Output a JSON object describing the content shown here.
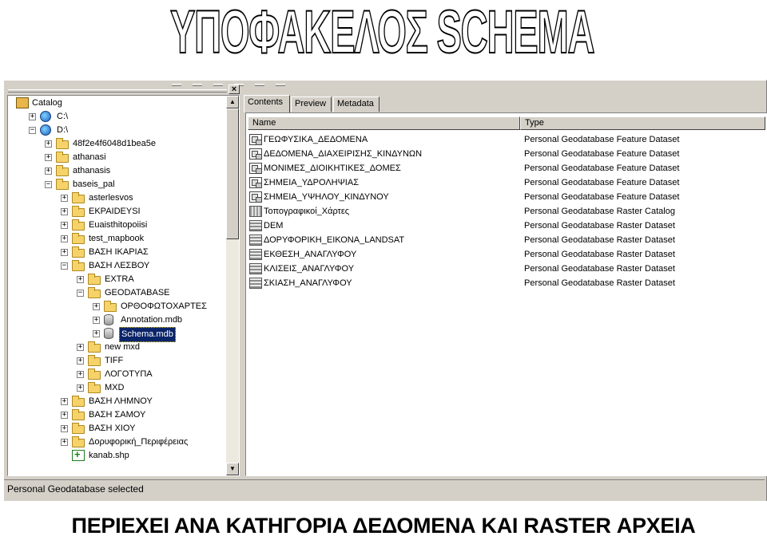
{
  "heading": "ΥΠΟΦΑΚΕΛΟΣ SCHEMA",
  "caption": "ΠΕΡΙΕΧΕΙ ΑΝΑ ΚΑΤΗΓΟΡΙΑ ΔΕΔΟΜΕΝΑ ΚΑΙ RASTER ΑΡΧΕΙΑ",
  "tree": {
    "close_label": "×",
    "items": [
      {
        "label": "Catalog",
        "icon": "catalog-icon",
        "expander": ""
      },
      {
        "label": "C:\\",
        "icon": "drive-icon",
        "expander": "+"
      },
      {
        "label": "D:\\",
        "icon": "drive-icon",
        "expander": "−"
      },
      {
        "label": "48f2e4f6048d1bea5e",
        "icon": "folder-icon",
        "expander": "+"
      },
      {
        "label": "athanasi",
        "icon": "folder-icon",
        "expander": "+"
      },
      {
        "label": "athanasis",
        "icon": "folder-icon",
        "expander": "+"
      },
      {
        "label": "baseis_pal",
        "icon": "folder-icon",
        "expander": "−"
      },
      {
        "label": "asterlesvos",
        "icon": "folder-icon",
        "expander": "+"
      },
      {
        "label": "EKPAIDEYSI",
        "icon": "folder-icon",
        "expander": "+"
      },
      {
        "label": "Euaisthitopoiisi",
        "icon": "folder-icon",
        "expander": "+"
      },
      {
        "label": "test_mapbook",
        "icon": "folder-icon",
        "expander": "+"
      },
      {
        "label": "ΒΑΣΗ ΙΚΑΡΙΑΣ",
        "icon": "folder-icon",
        "expander": "+"
      },
      {
        "label": "ΒΑΣΗ ΛΕΣΒΟΥ",
        "icon": "folder-icon",
        "expander": "−"
      },
      {
        "label": "EXTRA",
        "icon": "folder-icon",
        "expander": "+"
      },
      {
        "label": "GEODATABASE",
        "icon": "folder-icon",
        "expander": "−"
      },
      {
        "label": "ΟΡΘΟΦΩΤΟΧΑΡΤΕΣ",
        "icon": "folder-icon",
        "expander": "+"
      },
      {
        "label": "Annotation.mdb",
        "icon": "geodatabase-icon",
        "expander": "+"
      },
      {
        "label": "Schema.mdb",
        "icon": "geodatabase-icon",
        "expander": "+",
        "selected": true
      },
      {
        "label": "new mxd",
        "icon": "folder-icon",
        "expander": "+"
      },
      {
        "label": "TIFF",
        "icon": "folder-icon",
        "expander": "+"
      },
      {
        "label": "ΛΟΓΟΤΥΠΑ",
        "icon": "folder-icon",
        "expander": "+"
      },
      {
        "label": "MXD",
        "icon": "folder-icon",
        "expander": "+"
      },
      {
        "label": "ΒΑΣΗ ΛΗΜΝΟΥ",
        "icon": "folder-icon",
        "expander": "+"
      },
      {
        "label": "ΒΑΣΗ ΣΑΜΟΥ",
        "icon": "folder-icon",
        "expander": "+"
      },
      {
        "label": "ΒΑΣΗ ΧΙΟΥ",
        "icon": "folder-icon",
        "expander": "+"
      },
      {
        "label": "Δορυφορική_Περιφέρειας",
        "icon": "folder-icon",
        "expander": "+"
      },
      {
        "label": "kanab.shp",
        "icon": "shapefile-icon",
        "expander": ""
      }
    ],
    "scroll_up": "▲",
    "scroll_down": "▼"
  },
  "tabs": [
    {
      "label": "Contents",
      "active": true
    },
    {
      "label": "Preview",
      "active": false
    },
    {
      "label": "Metadata",
      "active": false
    }
  ],
  "contents": {
    "columns": [
      "Name",
      "Type"
    ],
    "rows": [
      {
        "name": "ΓΕΩΦΥΣΙΚΑ_ΔΕΔΟΜΕΝΑ",
        "type": "Personal Geodatabase Feature Dataset",
        "icon": "feature-dataset-icon"
      },
      {
        "name": "ΔΕΔΟΜΕΝΑ_ΔΙΑΧΕΙΡΙΣΗΣ_ΚΙΝΔΥΝΩΝ",
        "type": "Personal Geodatabase Feature Dataset",
        "icon": "feature-dataset-icon"
      },
      {
        "name": "ΜΟΝΙΜΕΣ_ΔΙΟΙΚΗΤΙΚΕΣ_ΔΟΜΕΣ",
        "type": "Personal Geodatabase Feature Dataset",
        "icon": "feature-dataset-icon"
      },
      {
        "name": "ΣΗΜΕΙΑ_ΥΔΡΟΛΗΨΙΑΣ",
        "type": "Personal Geodatabase Feature Dataset",
        "icon": "feature-dataset-icon"
      },
      {
        "name": "ΣΗΜΕΙΑ_ΥΨΗΛΟΥ_ΚΙΝΔΥΝΟΥ",
        "type": "Personal Geodatabase Feature Dataset",
        "icon": "feature-dataset-icon"
      },
      {
        "name": "Τοπογραφικοί_Χάρτες",
        "type": "Personal Geodatabase Raster Catalog",
        "icon": "raster-catalog-icon"
      },
      {
        "name": "DEM",
        "type": "Personal Geodatabase Raster Dataset",
        "icon": "raster-dataset-icon"
      },
      {
        "name": "ΔΟΡΥΦΟΡΙΚΗ_ΕΙΚΟΝΑ_LANDSAT",
        "type": "Personal Geodatabase Raster Dataset",
        "icon": "raster-dataset-icon"
      },
      {
        "name": "ΕΚΘΕΣΗ_ΑΝΑΓΛΥΦΟΥ",
        "type": "Personal Geodatabase Raster Dataset",
        "icon": "raster-dataset-icon"
      },
      {
        "name": "ΚΛΙΣΕΙΣ_ΑΝΑΓΛΥΦΟΥ",
        "type": "Personal Geodatabase Raster Dataset",
        "icon": "raster-dataset-icon"
      },
      {
        "name": "ΣΚΙΑΣΗ_ΑΝΑΓΛΥΦΟΥ",
        "type": "Personal Geodatabase Raster Dataset",
        "icon": "raster-dataset-icon"
      }
    ]
  },
  "status": "Personal Geodatabase selected"
}
